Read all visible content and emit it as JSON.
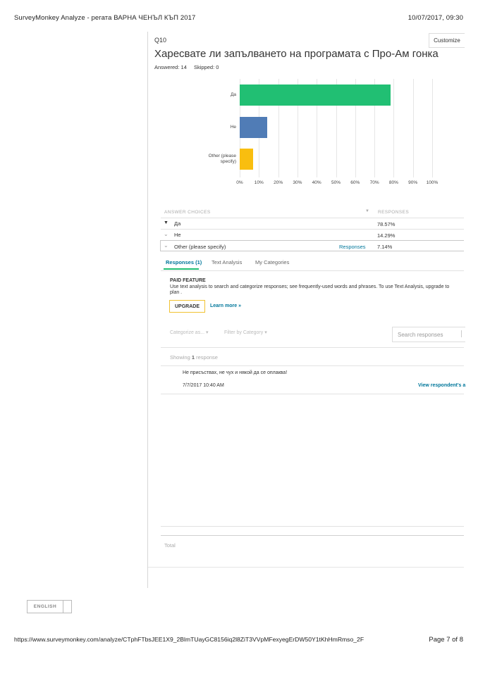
{
  "header": {
    "title": "SurveyMonkey Analyze - регата ВАРНА ЧЕНЪЛ КЪП 2017",
    "datetime": "10/07/2017, 09:30"
  },
  "question": {
    "number": "Q10",
    "customize_label": "Customize",
    "title": "Харесвате ли запълването на програмата с Про-Ам гонка",
    "answered": "Answered: 14",
    "skipped": "Skipped: 0"
  },
  "chart_data": {
    "type": "bar",
    "orientation": "horizontal",
    "categories": [
      "Да",
      "Не",
      "Other (please specify)"
    ],
    "values": [
      78.57,
      14.29,
      7.14
    ],
    "colors": [
      "#21bf73",
      "#507cb6",
      "#f9be0f"
    ],
    "xticks": [
      "0%",
      "10%",
      "20%",
      "30%",
      "40%",
      "50%",
      "60%",
      "70%",
      "80%",
      "90%",
      "100%"
    ],
    "xlim": [
      0,
      100
    ],
    "grid": true
  },
  "table": {
    "col_choices": "ANSWER CHOICES",
    "col_responses": "RESPONSES",
    "rows": [
      {
        "label": "Да",
        "value": "78.57%"
      },
      {
        "label": "Не",
        "value": "14.29%"
      },
      {
        "label": "Other (please specify)",
        "value": "7.14%",
        "link": "Responses"
      }
    ]
  },
  "tabs": [
    "Responses (1)",
    "Text Analysis",
    "My Categories"
  ],
  "paid": {
    "heading": "PAID FEATURE",
    "text": "Use text analysis to search and categorize responses; see frequently-used words and phrases. To use Text Analysis, upgrade to",
    "text2": "plan .",
    "upgrade": "UPGRADE",
    "learn": "Learn more »"
  },
  "filters": {
    "categorize": "Categorize as...",
    "filter": "Filter by Category",
    "search_placeholder": "Search responses"
  },
  "showing": {
    "prefix": "Showing ",
    "count": "1",
    "suffix": " response"
  },
  "response": {
    "text": "Не присъствах, не чух и някой да се оплаква!",
    "date": "7/7/2017 10:40 AM",
    "view_link": "View respondent's a"
  },
  "total_label": "Total",
  "language": "ENGLISH",
  "footer": {
    "url": "https://www.surveymonkey.com/analyze/CTphFTbsJEE1X9_2BlmTUayGC8156iq2l8ZiT3VVpMFexyegErDW50Y1tKhHmRmso_2F",
    "page": "Page 7 of 8"
  }
}
